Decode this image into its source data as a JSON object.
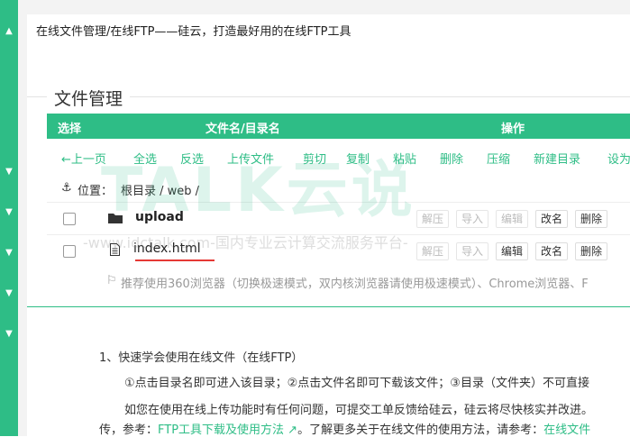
{
  "header": {
    "title": "在线文件管理/在线FTP——硅云，打造最好用的在线FTP工具"
  },
  "section": {
    "title": "文件管理"
  },
  "table": {
    "columns": [
      "选择",
      "文件名/目录名",
      "操作"
    ],
    "toolbar": [
      "←上一页",
      "全选",
      "反选",
      "上传文件",
      "剪切",
      "复制",
      "粘贴",
      "删除",
      "压缩",
      "新建目录",
      "设为"
    ],
    "location": {
      "label": "位置：",
      "path": "根目录 / web /"
    },
    "rows": [
      {
        "name": "upload",
        "type": "folder",
        "actions": [
          "解压",
          "导入",
          "编辑",
          "改名",
          "删除"
        ]
      },
      {
        "name": "index.html",
        "type": "file",
        "actions": [
          "解压",
          "导入",
          "编辑",
          "改名",
          "删除"
        ]
      }
    ],
    "notice": "推荐使用360浏览器（切换极速模式，双内核浏览器请使用极速模式）、Chrome浏览器、F"
  },
  "tips": {
    "heading": "1、快速学会使用在线文件（在线FTP）",
    "line1": "①点击目录名即可进入该目录；②点击文件名即可下载该文件；③目录（文件夹）不可直接",
    "line2": "如您在使用在线上传功能时有任何问题，可提交工单反馈给硅云，硅云将尽快核实并改进。",
    "line3_prefix": "传，参考：",
    "line3_link": "FTP工具下载及使用方法",
    "line3_mid": "。了解更多关于在线文件的使用方法，请参考：",
    "line3_link2": "在线文件"
  },
  "watermark": {
    "logo": "TALK云说",
    "url": "-www.idctalk.com-国内专业云计算交流服务平台-"
  },
  "colors": {
    "accent": "#2ebd86",
    "highlight_underline": "#e53935"
  }
}
